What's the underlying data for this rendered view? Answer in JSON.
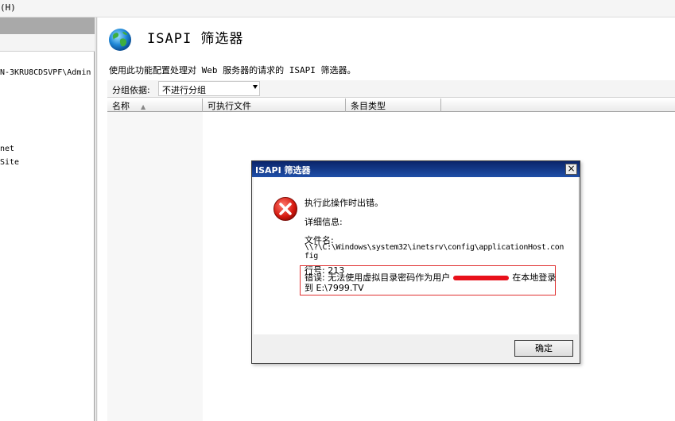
{
  "menubar": {
    "item": "(H)"
  },
  "tree": {
    "node_path": "N-3KRU8CDSVPF\\Admin",
    "node_net": "net",
    "node_site": "Site"
  },
  "feature": {
    "title": "ISAPI 筛选器",
    "description": "使用此功能配置处理对 Web 服务器的请求的 ISAPI 筛选器。",
    "group_label": "分组依据:",
    "group_value": "不进行分组",
    "columns": [
      "名称",
      "可执行文件",
      "条目类型"
    ],
    "icon": "globe-icon"
  },
  "dialog": {
    "title": "ISAPI 筛选器",
    "close_label": "×",
    "message": "执行此操作时出错。",
    "detail_label": "详细信息:",
    "filename_label": "文件名:",
    "filename_value": "\\\\?\\C:\\Windows\\system32\\inetsrv\\config\\applicationHost.config",
    "line_label": "行号: 213",
    "error_prefix": "错误: 无法使用虚拟目录密码作为用户",
    "error_suffix": "在本地登录到 E:\\7999.TV",
    "ok_label": "确定",
    "icon": "error-icon",
    "highlight_color": "#e03030"
  },
  "colors": {
    "titlebar": "#0a246a",
    "redaction": "#e8101a"
  }
}
